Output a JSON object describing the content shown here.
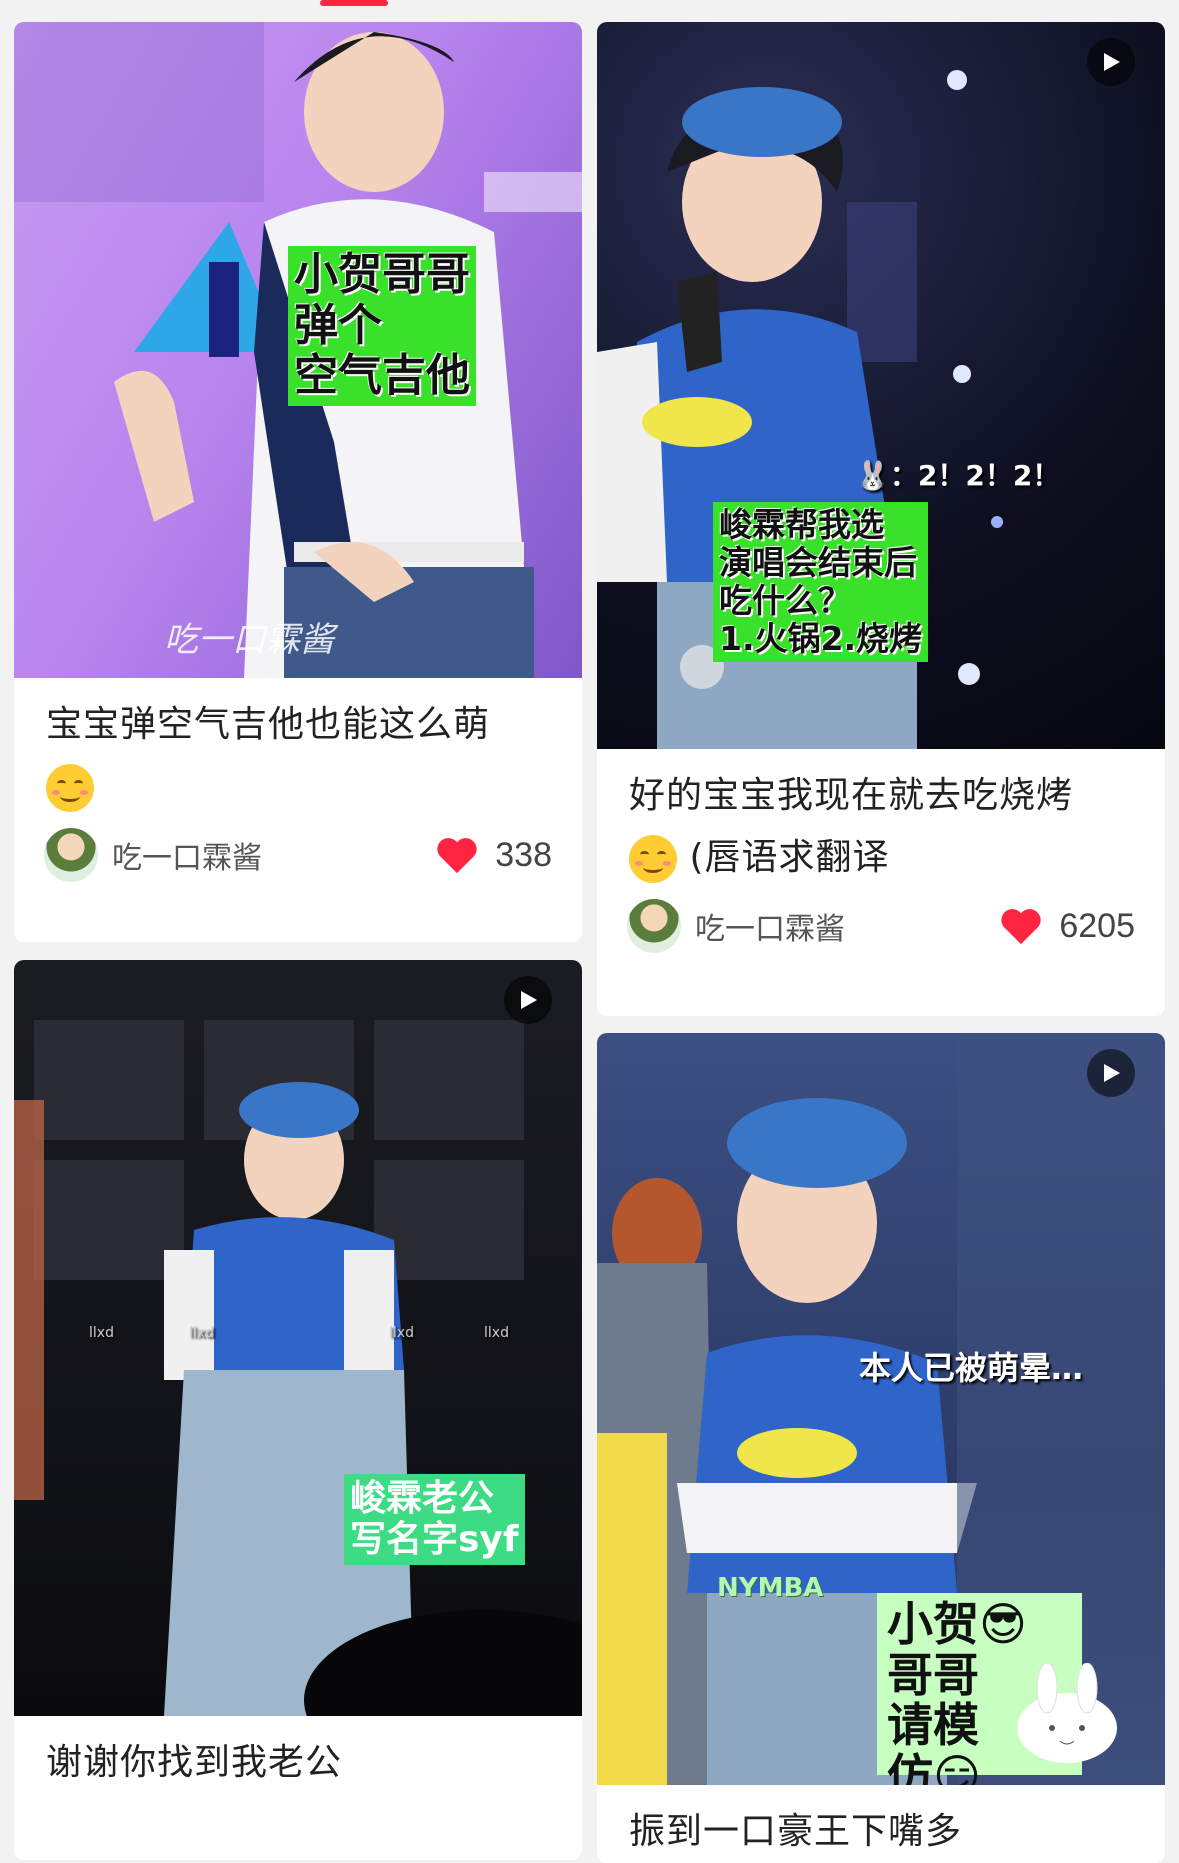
{
  "cards": [
    {
      "title": "宝宝弹空气吉他也能这么萌",
      "author": "吃一口霖酱",
      "likes": "338",
      "overlay": [
        "小贺哥哥",
        "弹个",
        "空气吉他"
      ],
      "watermark": "吃一口霖酱",
      "has_play": false,
      "emoji": "smiling-blush-emoji"
    },
    {
      "title": "好的宝宝我现在就去吃烧烤",
      "title_suffix": "(唇语求翻译",
      "author": "吃一口霖酱",
      "likes": "6205",
      "overlay": [
        "峻霖帮我选",
        "演唱会结束后",
        "吃什么？",
        "1.火锅2.烧烤"
      ],
      "caption_top": "🐰：2！2！2！",
      "has_play": true,
      "emoji": "drooling-emoji"
    },
    {
      "title": "谢谢你找到我老公",
      "overlay": [
        "峻霖老公",
        "写名字syf"
      ],
      "stage_labels": [
        "llxd",
        "llxd",
        "llxd",
        "llxd"
      ],
      "has_play": true
    },
    {
      "title": "振到一口豪王下嘴多",
      "overlay": [
        "小贺😎哥哥",
        "请模",
        "仿😏"
      ],
      "caption_top": "本人已被萌晕…",
      "logo_text": "NYMBA",
      "has_play": true
    }
  ],
  "colors": {
    "accent": "#ff2442",
    "overlay_green": "#39e12b",
    "overlay_light": "#c7ffc0",
    "heart": "#ff2442"
  }
}
